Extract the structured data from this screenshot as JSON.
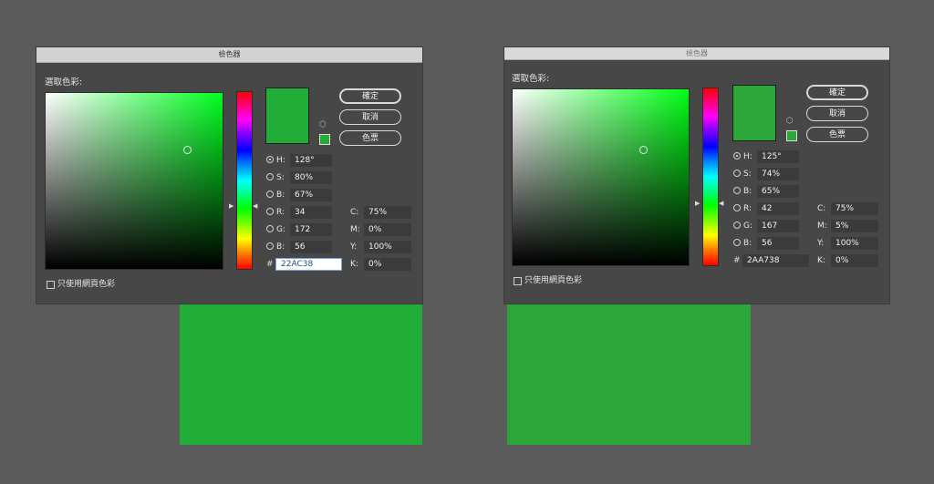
{
  "left": {
    "title": "檢色器",
    "pick_label": "選取色彩:",
    "buttons": {
      "ok": "確定",
      "cancel": "取消",
      "swatches": "色票"
    },
    "fields": [
      {
        "label": "H:",
        "value": "128°",
        "selected": true
      },
      {
        "label": "S:",
        "value": "80%",
        "selected": false
      },
      {
        "label": "B:",
        "value": "67%",
        "selected": false
      },
      {
        "label": "R:",
        "value": "34",
        "selected": false
      },
      {
        "label": "G:",
        "value": "172",
        "selected": false
      },
      {
        "label": "B:",
        "value": "56",
        "selected": false
      }
    ],
    "cmyk": [
      {
        "label": "C:",
        "value": "75%"
      },
      {
        "label": "M:",
        "value": "0%"
      },
      {
        "label": "Y:",
        "value": "100%"
      },
      {
        "label": "K:",
        "value": "0%"
      }
    ],
    "hash": "#",
    "hex": "22AC38",
    "web_only": "只使用網頁色彩",
    "color": "#22ac38",
    "hue_color": "#00ff20",
    "icon": "cube-icon"
  },
  "right": {
    "title": "檢色器",
    "pick_label": "選取色彩:",
    "buttons": {
      "ok": "確定",
      "cancel": "取消",
      "swatches": "色票"
    },
    "fields": [
      {
        "label": "H:",
        "value": "125°",
        "selected": true
      },
      {
        "label": "S:",
        "value": "74%",
        "selected": false
      },
      {
        "label": "B:",
        "value": "65%",
        "selected": false
      },
      {
        "label": "R:",
        "value": "42",
        "selected": false
      },
      {
        "label": "G:",
        "value": "167",
        "selected": false
      },
      {
        "label": "B:",
        "value": "56",
        "selected": false
      }
    ],
    "cmyk": [
      {
        "label": "C:",
        "value": "75%"
      },
      {
        "label": "M:",
        "value": "5%"
      },
      {
        "label": "Y:",
        "value": "100%"
      },
      {
        "label": "K:",
        "value": "0%"
      }
    ],
    "hash": "#",
    "hex": "2AA738",
    "web_only": "只使用網頁色彩",
    "color": "#2aa738",
    "hue_color": "#00ff15",
    "icon": "cube-icon"
  }
}
